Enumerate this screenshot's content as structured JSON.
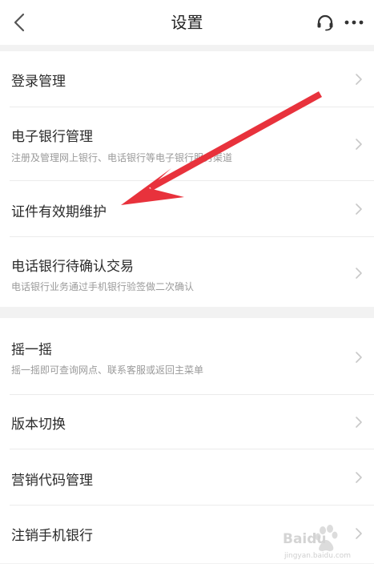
{
  "header": {
    "title": "设置",
    "back_icon": "chevron-left-icon",
    "support_icon": "headset-icon",
    "more_icon": "more-dots-icon"
  },
  "group1": {
    "items": [
      {
        "title": "登录管理",
        "subtitle": ""
      },
      {
        "title": "电子银行管理",
        "subtitle": "注册及管理网上银行、电话银行等电子银行服务渠道"
      },
      {
        "title": "证件有效期维护",
        "subtitle": ""
      },
      {
        "title": "电话银行待确认交易",
        "subtitle": "电话银行业务通过手机银行验签做二次确认"
      }
    ]
  },
  "group2": {
    "items": [
      {
        "title": "摇一摇",
        "subtitle": "摇一摇即可查询网点、联系客服或返回主菜单"
      },
      {
        "title": "版本切换",
        "subtitle": ""
      },
      {
        "title": "营销代码管理",
        "subtitle": ""
      },
      {
        "title": "注销手机银行",
        "subtitle": ""
      }
    ]
  },
  "annotation": {
    "arrow_color": "#e8323c"
  },
  "watermark": {
    "brand": "Baidu",
    "subtext": "jingyan.baidu.com"
  },
  "colors": {
    "background": "#f2f2f2",
    "card": "#ffffff",
    "title_text": "#2b2b2b",
    "subtitle_text": "#9a9a9a",
    "chevron": "#c8c8c8"
  }
}
